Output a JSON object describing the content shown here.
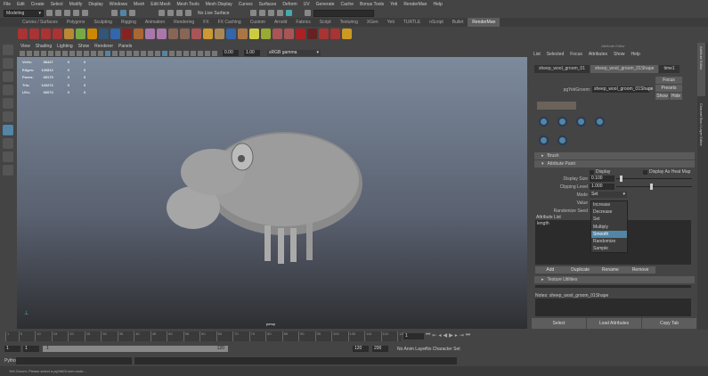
{
  "menu": [
    "File",
    "Edit",
    "Create",
    "Select",
    "Modify",
    "Display",
    "Windows",
    "Mesh",
    "Edit Mesh",
    "Mesh Tools",
    "Mesh Display",
    "Curves",
    "Surfaces",
    "Deform",
    "UV",
    "Generate",
    "Cache",
    "Bonus Tools",
    "Yeti",
    "RenderMan",
    "Help"
  ],
  "toolbar": {
    "mode": "Modeling",
    "live": "No Live Surface"
  },
  "shelf_tabs": [
    "Curves / Surfaces",
    "Polygons",
    "Sculpting",
    "Rigging",
    "Animation",
    "Rendering",
    "FX",
    "FX Caching",
    "Custom",
    "Arnold",
    "Fabrics",
    "Script",
    "Texturing",
    "XGen",
    "Yeti",
    "TURTLE",
    "nScript",
    "Bullet",
    "RenderMan"
  ],
  "shelf_active": "RenderMan",
  "shelf_icon_colors": [
    "#a33",
    "#a33",
    "#a33",
    "#a33",
    "#b83",
    "#7a4",
    "#c80",
    "#357",
    "#36a",
    "#822",
    "#a63",
    "#a7a",
    "#a7a",
    "#865",
    "#865",
    "#a55",
    "#c93",
    "#a85",
    "#36a",
    "#a74",
    "#cc4",
    "#9a3",
    "#a55",
    "#a55",
    "#a22",
    "#622",
    "#a33",
    "#a33",
    "#c92"
  ],
  "viewport": {
    "menu": [
      "View",
      "Shading",
      "Lighting",
      "Show",
      "Renderer",
      "Panels"
    ],
    "exposure": "0.00",
    "gamma": "1.00",
    "color_space": "sRGB gamma",
    "camera": "persp",
    "stats": [
      [
        "Verts:",
        "58447",
        "0",
        "0"
      ],
      [
        "Edges:",
        "126812",
        "0",
        "0"
      ],
      [
        "Faces:",
        "68170",
        "0",
        "0"
      ],
      [
        "Tris:",
        "126272",
        "0",
        "0"
      ],
      [
        "UVs:",
        "60073",
        "0",
        "0"
      ]
    ]
  },
  "ae": {
    "title": "Attribute Editor",
    "menu": [
      "List",
      "Selected",
      "Focus",
      "Attributes",
      "Show",
      "Help"
    ],
    "tabs": [
      "sheep_wool_groom_01",
      "sheep_wool_groom_01Shape",
      "time1"
    ],
    "active_tab": 1,
    "node_label": "pgYetiGroom:",
    "node_value": "sheep_wool_groom_01Shape",
    "focus": "Focus",
    "presets": "Presets",
    "show": "Show",
    "hide": "Hide",
    "brush": "Brush",
    "attr_paint": "Attribute Paint",
    "display": "Display",
    "heatmap": "Display As Heat Map",
    "display_size_label": "Display Size",
    "display_size": "0.100",
    "display_size_frac": 0.05,
    "clipping_label": "Clipping Level",
    "clipping": "1.000",
    "clipping_frac": 0.45,
    "mode_label": "Mode",
    "mode": "Set",
    "value_label": "Value",
    "rand_label": "Randomize Seed",
    "mode_options": [
      "Increase",
      "Decrease",
      "Set",
      "Multiply",
      "Smooth",
      "Randomize",
      "Sample"
    ],
    "mode_highlight": 4,
    "attr_list_label": "Attribute List",
    "attr_list": [
      "length"
    ],
    "list_buttons": [
      "Add",
      "Duplicate",
      "Rename",
      "Remove"
    ],
    "texture": "Texture Utilities",
    "notes": "Notes: sheep_wool_groom_01Shape",
    "bottom": [
      "Select",
      "Load Attributes",
      "Copy Tab"
    ]
  },
  "right_tabs": [
    "Attribute Editor",
    "Channel Box / Layer Editor"
  ],
  "timeline": {
    "ticks": [
      "1",
      "5",
      "10",
      "15",
      "20",
      "25",
      "30",
      "35",
      "40",
      "45",
      "50",
      "55",
      "60",
      "65",
      "70",
      "75",
      "80",
      "85",
      "90",
      "95",
      "100",
      "105",
      "110",
      "115",
      "120"
    ],
    "current": "1"
  },
  "range": {
    "start": "1",
    "start2": "1",
    "inner_start": "1",
    "inner_end": "120",
    "end": "120",
    "end2": "200",
    "anim_layer": "No Anim Layer",
    "char_set": "No Character Set"
  },
  "python": "Python",
  "help": "Yeti Groom: Please select a pgYetiGroom node..."
}
